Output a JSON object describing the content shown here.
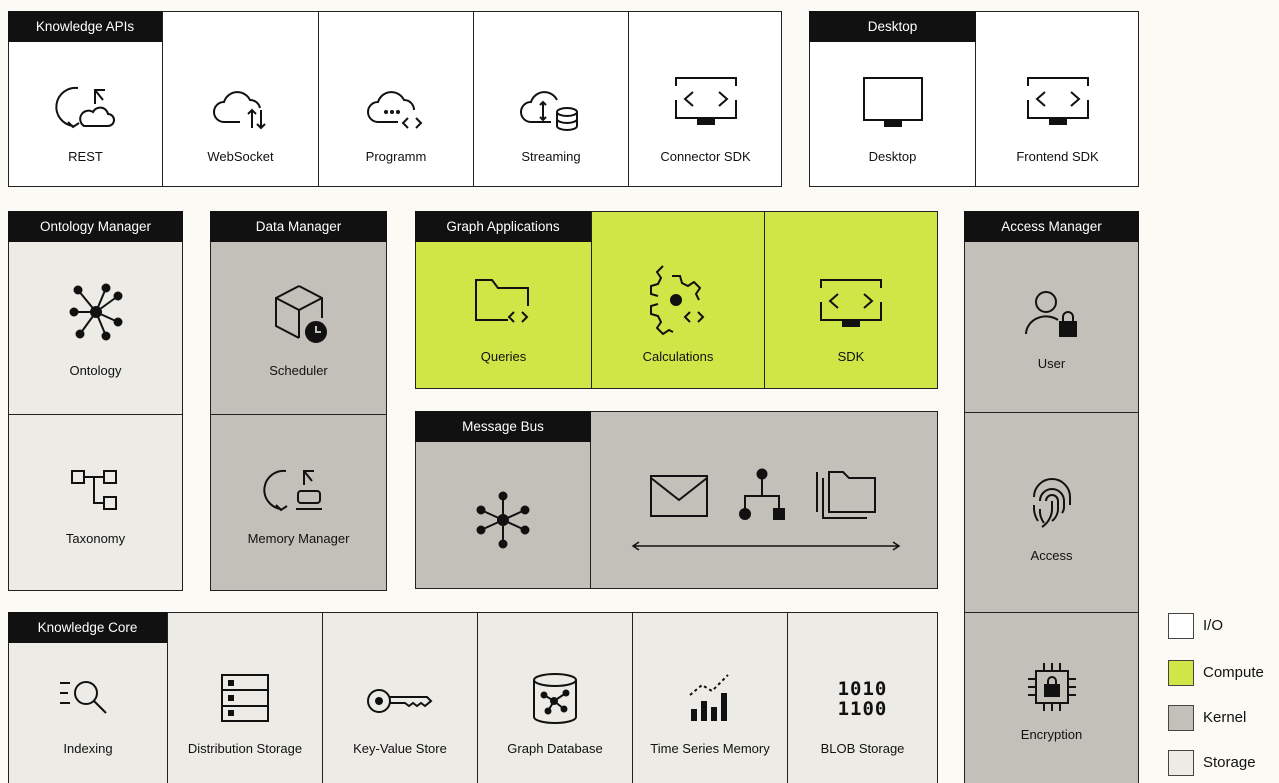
{
  "colors": {
    "io": "#ffffff",
    "compute": "#cfe647",
    "kernel": "#c2c0b9",
    "storage": "#ecebe5",
    "header": "#111111"
  },
  "knowledge_apis": {
    "title": "Knowledge APIs",
    "items": [
      {
        "label": "REST",
        "icon": "refresh-cloud-icon"
      },
      {
        "label": "WebSocket",
        "icon": "cloud-updown-icon"
      },
      {
        "label": "Programm",
        "icon": "cloud-code-icon"
      },
      {
        "label": "Streaming",
        "icon": "cloud-database-icon"
      },
      {
        "label": "Connector SDK",
        "icon": "monitor-code-icon"
      }
    ]
  },
  "desktop": {
    "title": "Desktop",
    "items": [
      {
        "label": "Desktop",
        "icon": "monitor-icon"
      },
      {
        "label": "Frontend SDK",
        "icon": "monitor-code-icon"
      }
    ]
  },
  "ontology_manager": {
    "title": "Ontology Manager",
    "items": [
      {
        "label": "Ontology",
        "icon": "network-icon"
      },
      {
        "label": "Taxonomy",
        "icon": "hierarchy-icon"
      }
    ]
  },
  "data_manager": {
    "title": "Data Manager",
    "items": [
      {
        "label": "Scheduler",
        "icon": "cube-clock-icon"
      },
      {
        "label": "Memory Manager",
        "icon": "refresh-drive-icon"
      }
    ]
  },
  "graph_applications": {
    "title": "Graph Applications",
    "items": [
      {
        "label": "Queries",
        "icon": "folder-code-icon"
      },
      {
        "label": "Calculations",
        "icon": "gear-code-icon"
      },
      {
        "label": "SDK",
        "icon": "monitor-code-icon"
      }
    ]
  },
  "message_bus": {
    "title": "Message Bus"
  },
  "access_manager": {
    "title": "Access Manager",
    "items": [
      {
        "label": "User",
        "icon": "user-lock-icon"
      },
      {
        "label": "Access",
        "icon": "fingerprint-icon"
      },
      {
        "label": "Encryption",
        "icon": "chip-lock-icon"
      }
    ]
  },
  "knowledge_core": {
    "title": "Knowledge Core",
    "items": [
      {
        "label": "Indexing",
        "icon": "search-list-icon"
      },
      {
        "label": "Distribution Storage",
        "icon": "server-icon"
      },
      {
        "label": "Key-Value Store",
        "icon": "key-icon"
      },
      {
        "label": "Graph Database",
        "icon": "graph-database-icon"
      },
      {
        "label": "Time Series Memory",
        "icon": "chart-trend-icon"
      },
      {
        "label": "BLOB Storage",
        "icon": "binary-icon"
      }
    ],
    "binary_text": [
      "1010",
      "1100"
    ]
  },
  "legend": [
    {
      "label": "I/O"
    },
    {
      "label": "Compute"
    },
    {
      "label": "Kernel"
    },
    {
      "label": "Storage"
    }
  ]
}
